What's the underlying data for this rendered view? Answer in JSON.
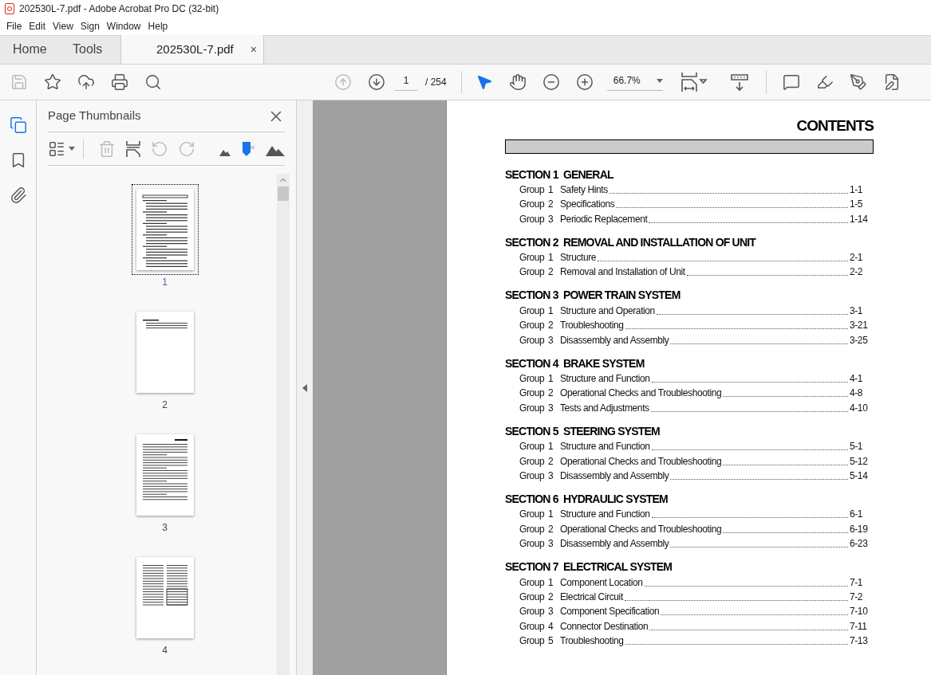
{
  "window": {
    "title": "202530L-7.pdf - Adobe Acrobat Pro DC (32-bit)"
  },
  "menu": [
    "File",
    "Edit",
    "View",
    "Sign",
    "Window",
    "Help"
  ],
  "tabs": [
    {
      "label": "Home",
      "kind": "nav",
      "selected": false
    },
    {
      "label": "Tools",
      "kind": "nav",
      "selected": false
    },
    {
      "label": "202530L-7.pdf",
      "kind": "document",
      "selected": true,
      "close": "×"
    }
  ],
  "toolbar": {
    "page_number": "1",
    "page_total": "/ 254",
    "zoom": "66.7%"
  },
  "panel": {
    "title": "Page Thumbnails",
    "thumbnails": [
      {
        "label": "1",
        "selected": true,
        "kind": "contents"
      },
      {
        "label": "2",
        "selected": false,
        "kind": "short"
      },
      {
        "label": "3",
        "selected": false,
        "kind": "text"
      },
      {
        "label": "4",
        "selected": false,
        "kind": "columns"
      }
    ]
  },
  "document": {
    "heading": "CONTENTS",
    "sections": [
      {
        "title": "SECTION 1  GENERAL",
        "groups": [
          {
            "label": "Group",
            "number": "1",
            "title": "Safety Hints",
            "page": "1-1"
          },
          {
            "label": "Group",
            "number": "2",
            "title": "Specifications",
            "page": "1-5"
          },
          {
            "label": "Group",
            "number": "3",
            "title": "Periodic Replacement",
            "page": "1-14"
          }
        ]
      },
      {
        "title": "SECTION 2  REMOVAL AND INSTALLATION OF UNIT",
        "groups": [
          {
            "label": "Group",
            "number": "1",
            "title": "Structure",
            "page": "2-1"
          },
          {
            "label": "Group",
            "number": "2",
            "title": "Removal and Installation of Unit",
            "page": "2-2"
          }
        ]
      },
      {
        "title": "SECTION 3  POWER TRAIN SYSTEM",
        "groups": [
          {
            "label": "Group",
            "number": "1",
            "title": "Structure and Operation",
            "page": "3-1"
          },
          {
            "label": "Group",
            "number": "2",
            "title": "Troubleshooting",
            "page": "3-21"
          },
          {
            "label": "Group",
            "number": "3",
            "title": "Disassembly and Assembly",
            "page": "3-25"
          }
        ]
      },
      {
        "title": "SECTION 4  BRAKE SYSTEM",
        "groups": [
          {
            "label": "Group",
            "number": "1",
            "title": "Structure and Function",
            "page": "4-1"
          },
          {
            "label": "Group",
            "number": "2",
            "title": "Operational Checks and Troubleshooting",
            "page": "4-8"
          },
          {
            "label": "Group",
            "number": "3",
            "title": "Tests and Adjustments",
            "page": "4-10"
          }
        ]
      },
      {
        "title": "SECTION 5  STEERING SYSTEM",
        "groups": [
          {
            "label": "Group",
            "number": "1",
            "title": "Structure and Function",
            "page": "5-1"
          },
          {
            "label": "Group",
            "number": "2",
            "title": "Operational Checks and Troubleshooting",
            "page": "5-12"
          },
          {
            "label": "Group",
            "number": "3",
            "title": "Disassembly and Assembly",
            "page": "5-14"
          }
        ]
      },
      {
        "title": "SECTION 6  HYDRAULIC SYSTEM",
        "groups": [
          {
            "label": "Group",
            "number": "1",
            "title": "Structure and Function",
            "page": "6-1"
          },
          {
            "label": "Group",
            "number": "2",
            "title": "Operational Checks and Troubleshooting",
            "page": "6-19"
          },
          {
            "label": "Group",
            "number": "3",
            "title": "Disassembly and Assembly",
            "page": "6-23"
          }
        ]
      },
      {
        "title": "SECTION 7  ELECTRICAL SYSTEM",
        "groups": [
          {
            "label": "Group",
            "number": "1",
            "title": "Component Location",
            "page": "7-1"
          },
          {
            "label": "Group",
            "number": "2",
            "title": "Electrical Circuit",
            "page": "7-2"
          },
          {
            "label": "Group",
            "number": "3",
            "title": "Component Specification",
            "page": "7-10"
          },
          {
            "label": "Group",
            "number": "4",
            "title": "Connector Destination",
            "page": "7-11"
          },
          {
            "label": "Group",
            "number": "5",
            "title": "Troubleshooting",
            "page": "7-13"
          }
        ]
      }
    ]
  }
}
